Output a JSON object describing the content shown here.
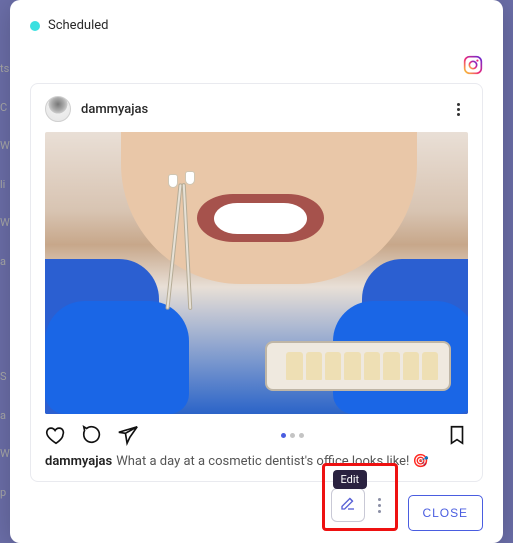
{
  "status": {
    "label": "Scheduled",
    "color": "#3be0e0"
  },
  "platform": {
    "name": "instagram"
  },
  "post": {
    "username": "dammyajas",
    "caption_user": "dammyajas",
    "caption_text": "What a day at a cosmetic dentist's office looks like! 🎯",
    "carousel_index": 0,
    "carousel_count": 3
  },
  "footer": {
    "edit_tooltip": "Edit",
    "close_label": "CLOSE"
  }
}
